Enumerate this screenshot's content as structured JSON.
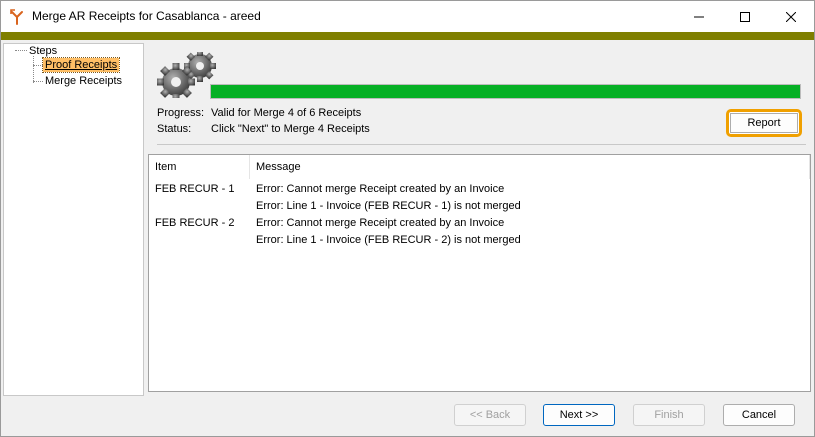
{
  "window": {
    "title": "Merge AR Receipts for Casablanca - areed",
    "accent_bar_color": "#7f7f00"
  },
  "sidebar": {
    "root_label": "Steps",
    "items": [
      {
        "label": "Proof Receipts",
        "selected": true
      },
      {
        "label": "Merge Receipts",
        "selected": false
      }
    ]
  },
  "progress": {
    "fraction": 1.0,
    "bar_color": "#06b025",
    "progress_key": "Progress:",
    "progress_value": "Valid for Merge 4 of 6 Receipts",
    "status_key": "Status:",
    "status_value": "Click \"Next\" to Merge 4 Receipts"
  },
  "report_button": {
    "label": "Report"
  },
  "list": {
    "columns": [
      "Item",
      "Message"
    ],
    "rows": [
      {
        "item": "FEB RECUR - 1",
        "messages": [
          "Error: Cannot merge Receipt created by an Invoice",
          "Error: Line 1 - Invoice (FEB RECUR - 1) is not merged"
        ]
      },
      {
        "item": "FEB RECUR - 2",
        "messages": [
          "Error: Cannot merge Receipt created by an Invoice",
          "Error: Line 1 - Invoice (FEB RECUR - 2) is not merged"
        ]
      }
    ]
  },
  "footer": {
    "back_label": "<< Back",
    "next_label": "Next >>",
    "finish_label": "Finish",
    "cancel_label": "Cancel"
  }
}
